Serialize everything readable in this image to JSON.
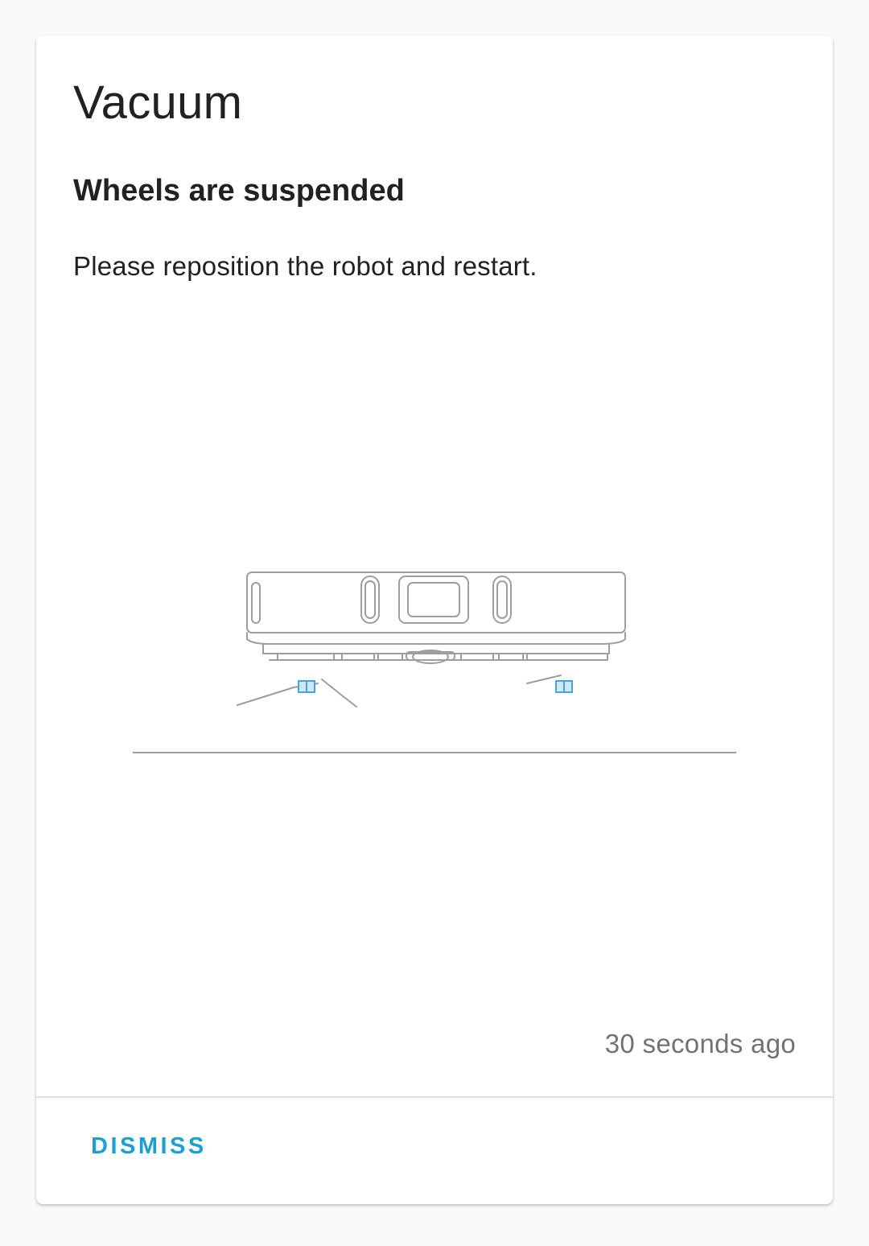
{
  "card": {
    "title": "Vacuum",
    "subtitle": "Wheels are suspended",
    "message": "Please reposition the robot and restart.",
    "timestamp": "30 seconds ago",
    "dismiss_label": "DISMISS"
  },
  "illustration": {
    "icon": "robot-vacuum-wheels-suspended-illustration",
    "outline_color": "#9e9e9e",
    "highlight_color": "#4aa3df"
  },
  "colors": {
    "accent": "#1a9fd9",
    "text_primary": "#212121",
    "text_secondary": "#727272"
  }
}
